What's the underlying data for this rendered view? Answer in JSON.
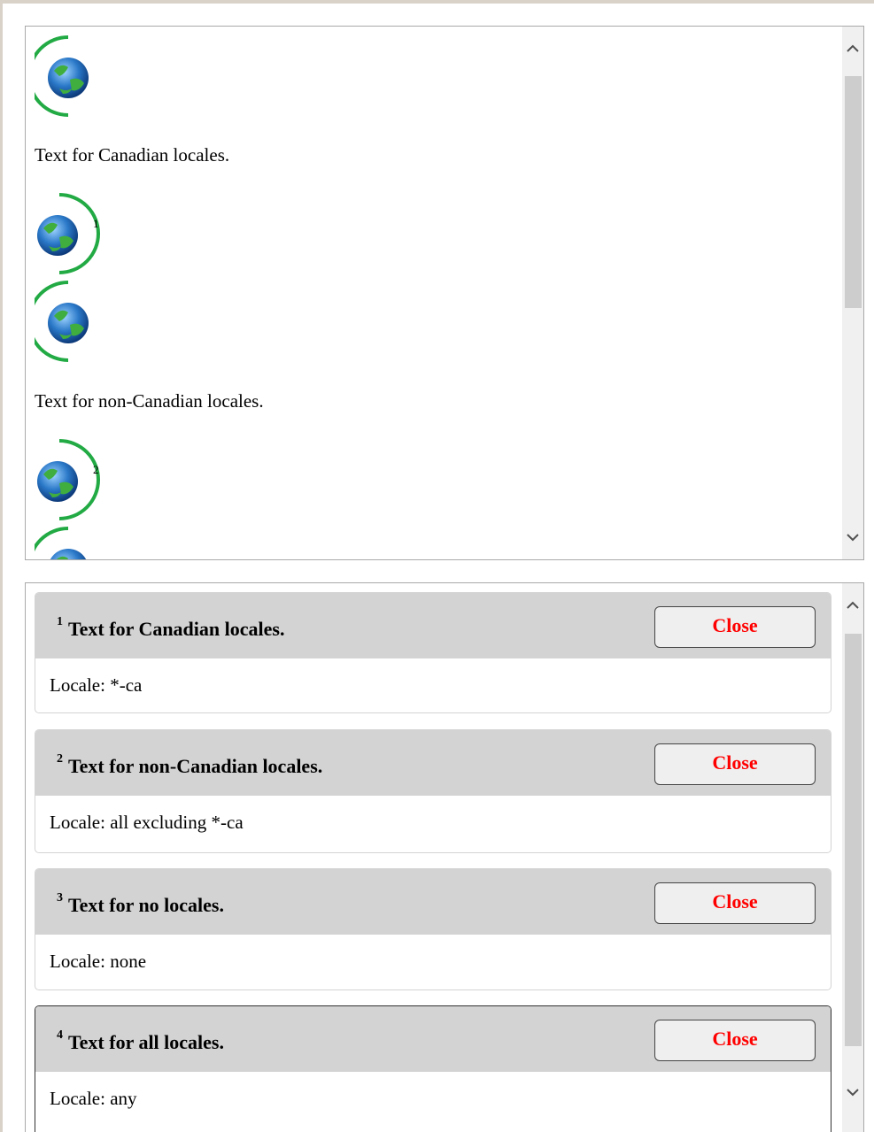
{
  "content": {
    "paragraphs": [
      "Text for Canadian locales.",
      "Text for non-Canadian locales."
    ],
    "footnote_refs": [
      "1",
      "2"
    ]
  },
  "notes": [
    {
      "num": "1",
      "title": "Text for Canadian locales.",
      "locale": "Locale: *-ca",
      "close": "Close"
    },
    {
      "num": "2",
      "title": "Text for non-Canadian locales.",
      "locale": "Locale: all excluding *-ca",
      "close": "Close"
    },
    {
      "num": "3",
      "title": "Text for no locales.",
      "locale": "Locale: none",
      "close": "Close"
    },
    {
      "num": "4",
      "title": "Text for all locales.",
      "locale": "Locale: any",
      "close": "Close"
    }
  ],
  "colors": {
    "close_text": "#ff0000",
    "header_bg": "#d3d3d3",
    "bracket_green": "#22aa44"
  },
  "icons": [
    "globe-icon",
    "chevron-up-icon",
    "chevron-down-icon"
  ]
}
